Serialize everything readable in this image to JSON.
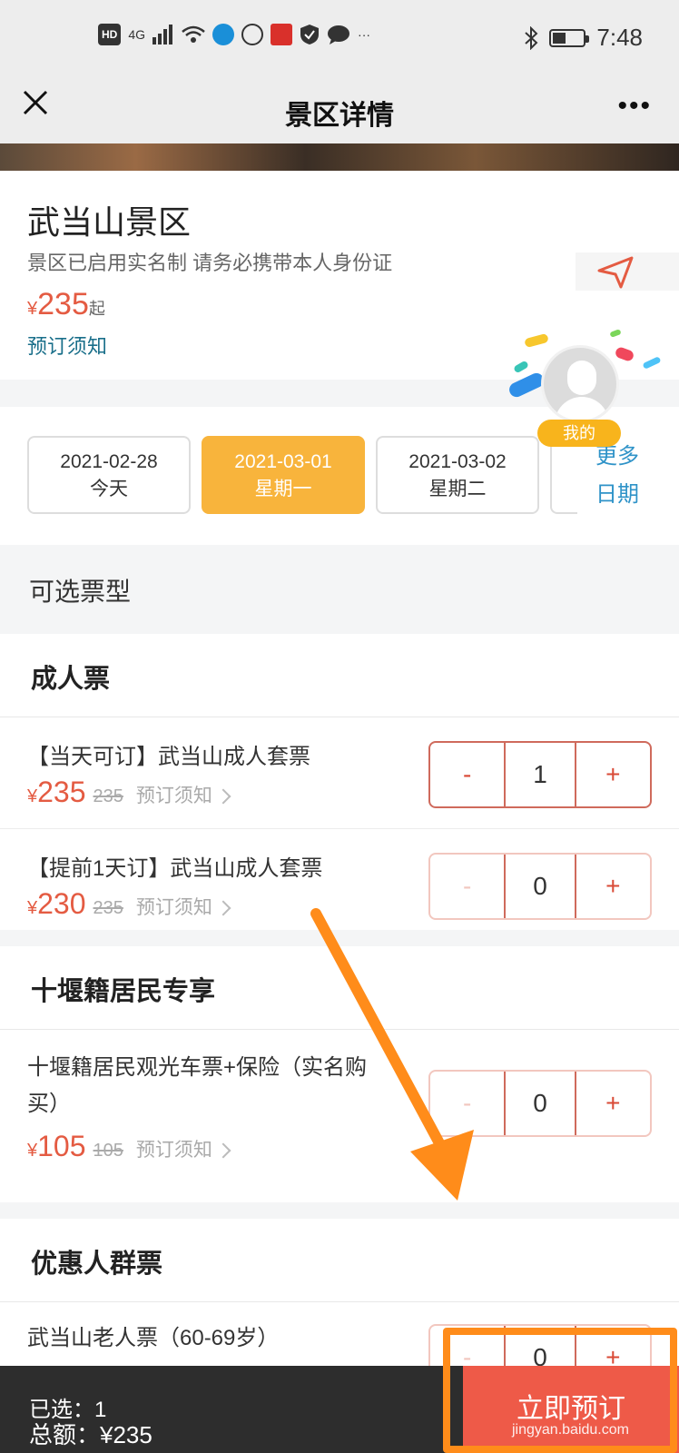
{
  "statusbar": {
    "network_badge": "HD",
    "network_type": "4G",
    "more": "···",
    "time": "7:48"
  },
  "navbar": {
    "title": "景区详情",
    "more": "•••"
  },
  "spot": {
    "name": "武当山景区",
    "notice": "景区已启用实名制 请务必携带本人身份证",
    "price_symbol": "¥",
    "price": "235",
    "price_suffix": "起",
    "booking_link": "预订须知"
  },
  "avatar": {
    "badge": "我的"
  },
  "dates": [
    {
      "date": "2021-02-28",
      "day": "今天"
    },
    {
      "date": "2021-03-01",
      "day": "星期一"
    },
    {
      "date": "2021-03-02",
      "day": "星期二"
    }
  ],
  "more_dates": "更多日期",
  "section_title": "可选票型",
  "groups": [
    {
      "title": "成人票",
      "tickets": [
        {
          "name": "【当天可订】武当山成人套票",
          "symbol": "¥",
          "price": "235",
          "original": "235",
          "link": "预订须知",
          "minus": "-",
          "qty": "1",
          "plus": "+"
        },
        {
          "name": "【提前1天订】武当山成人套票",
          "symbol": "¥",
          "price": "230",
          "original": "235",
          "link": "预订须知",
          "minus": "-",
          "qty": "0",
          "plus": "+"
        }
      ]
    },
    {
      "title": "十堰籍居民专享",
      "tickets": [
        {
          "name": "十堰籍居民观光车票+保险（实名购买）",
          "symbol": "¥",
          "price": "105",
          "original": "105",
          "link": "预订须知",
          "minus": "-",
          "qty": "0",
          "plus": "+"
        }
      ]
    },
    {
      "title": "优惠人群票",
      "tickets": [
        {
          "name": "武当山老人票（60-69岁）",
          "minus": "-",
          "qty": "0",
          "plus": "+"
        }
      ]
    }
  ],
  "bottom": {
    "selected": "已选：1",
    "total": "总额：¥235",
    "submit": "立即预订",
    "watermark": "jingyan.baidu.com"
  },
  "colors": {
    "accent": "#e45b42",
    "date_active": "#f8b43c",
    "link": "#1a6f8a",
    "more_dates": "#2f93c8",
    "bottom_bar": "#2d2d2d",
    "submit": "#ee5a48",
    "annotation": "#ff8c1a"
  }
}
